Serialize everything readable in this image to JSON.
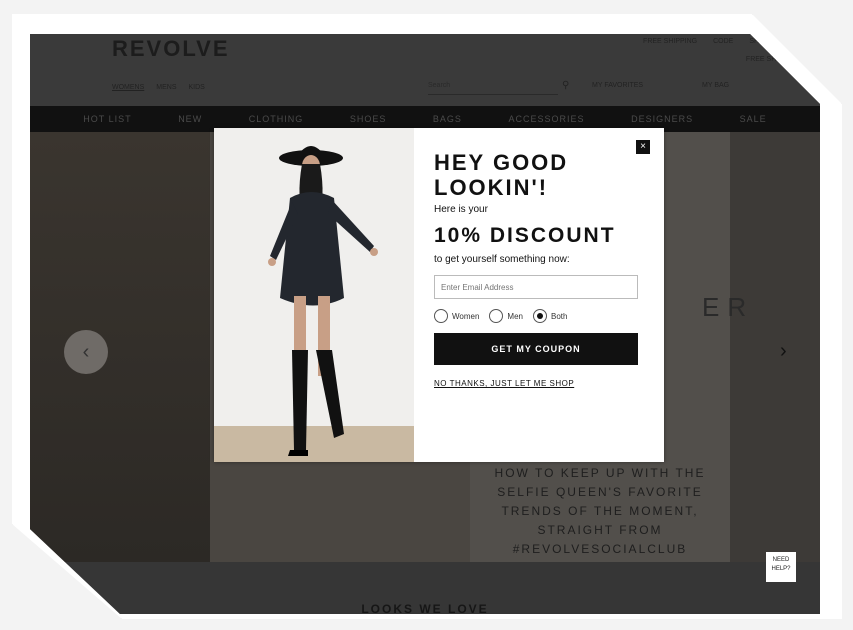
{
  "site": {
    "logo": "REVOLVE",
    "top_links": [
      "FREE SHIPPING",
      "CODE",
      "SHIP",
      "HELP"
    ],
    "free_shipping": "FREE SHIPPING",
    "secondary_nav": [
      "WOMENS",
      "MENS",
      "KIDS"
    ],
    "search_placeholder": "Search",
    "account": "MY FAVORITES",
    "bag": "MY BAG",
    "menu": [
      "HOT LIST",
      "NEW",
      "CLOTHING",
      "SHOES",
      "BAGS",
      "ACCESSORIES",
      "DESIGNERS",
      "SALE"
    ],
    "hero_word": "ER",
    "promo_text": "HOW TO KEEP UP WITH THE SELFIE QUEEN'S FAVORITE TRENDS OF THE MOMENT, STRAIGHT FROM #REVOLVESOCIALCLUB",
    "section_title": "LOOKS WE LOVE",
    "chat_label": "NEED HELP?"
  },
  "modal": {
    "headline": "HEY GOOD LOOKIN'!",
    "sub1": "Here is your",
    "discount": "10% DISCOUNT",
    "sub2": "to get yourself something now:",
    "email_placeholder": "Enter Email Address",
    "options": [
      {
        "label": "Women",
        "selected": false
      },
      {
        "label": "Men",
        "selected": false
      },
      {
        "label": "Both",
        "selected": true
      }
    ],
    "cta": "GET MY COUPON",
    "no_thanks": "NO THANKS, JUST LET ME SHOP",
    "close": "×"
  },
  "colors": {
    "modal_bg": "#ffffff",
    "cta_bg": "#111111",
    "overlay": "#444444"
  }
}
